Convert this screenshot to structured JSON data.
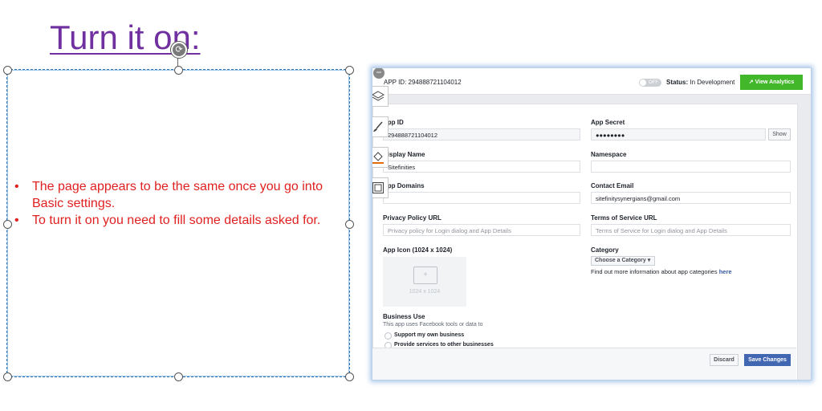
{
  "slide": {
    "title": "Turn it on:",
    "bullets": [
      "The page appears to be the same  once you go into Basic settings.",
      "To turn it on you need to fill some details asked for."
    ]
  },
  "screenshot": {
    "topbar": {
      "app_id_label": "APP ID: 294888721104012",
      "toggle_label": "OFF",
      "status_label": "Status:",
      "status_value": "In Development",
      "analytics_button": "View Analytics"
    },
    "fields": {
      "app_id": {
        "label": "App ID",
        "value": "294888721104012"
      },
      "app_secret": {
        "label": "App Secret",
        "value": "●●●●●●●●",
        "button": "Show"
      },
      "display_name": {
        "label": "Display Name",
        "value": "Sitefinities"
      },
      "namespace": {
        "label": "Namespace",
        "value": ""
      },
      "app_domains": {
        "label": "App Domains",
        "value": ""
      },
      "contact_email": {
        "label": "Contact Email",
        "value": "sitefinitysynergians@gmail.com"
      },
      "privacy_url": {
        "label": "Privacy Policy URL",
        "placeholder": "Privacy policy for Login dialog and App Details"
      },
      "tos_url": {
        "label": "Terms of Service URL",
        "placeholder": "Terms of Service for Login dialog and App Details"
      }
    },
    "app_icon": {
      "label": "App Icon (1024 x 1024)",
      "size_text": "1024 x 1024"
    },
    "category": {
      "label": "Category",
      "button": "Choose a Category ▾",
      "info": "Find out more information about app categories",
      "link": "here"
    },
    "business_use": {
      "label": "Business Use",
      "desc": "This app uses Facebook tools or data to",
      "options": [
        "Support my own business",
        "Provide services to other businesses"
      ]
    },
    "footer": {
      "discard": "Discard",
      "save": "Save Changes"
    }
  },
  "colors": {
    "title": "#7030a0",
    "bullet_text": "#e02020",
    "analytics_green": "#42b72a",
    "save_blue": "#4267b2",
    "selection_blue": "#2e75b6"
  },
  "icons": [
    "rotate-icon",
    "layers-icon",
    "brush-icon",
    "fill-bucket-icon",
    "frame-icon",
    "minus-icon",
    "image-placeholder-icon"
  ]
}
